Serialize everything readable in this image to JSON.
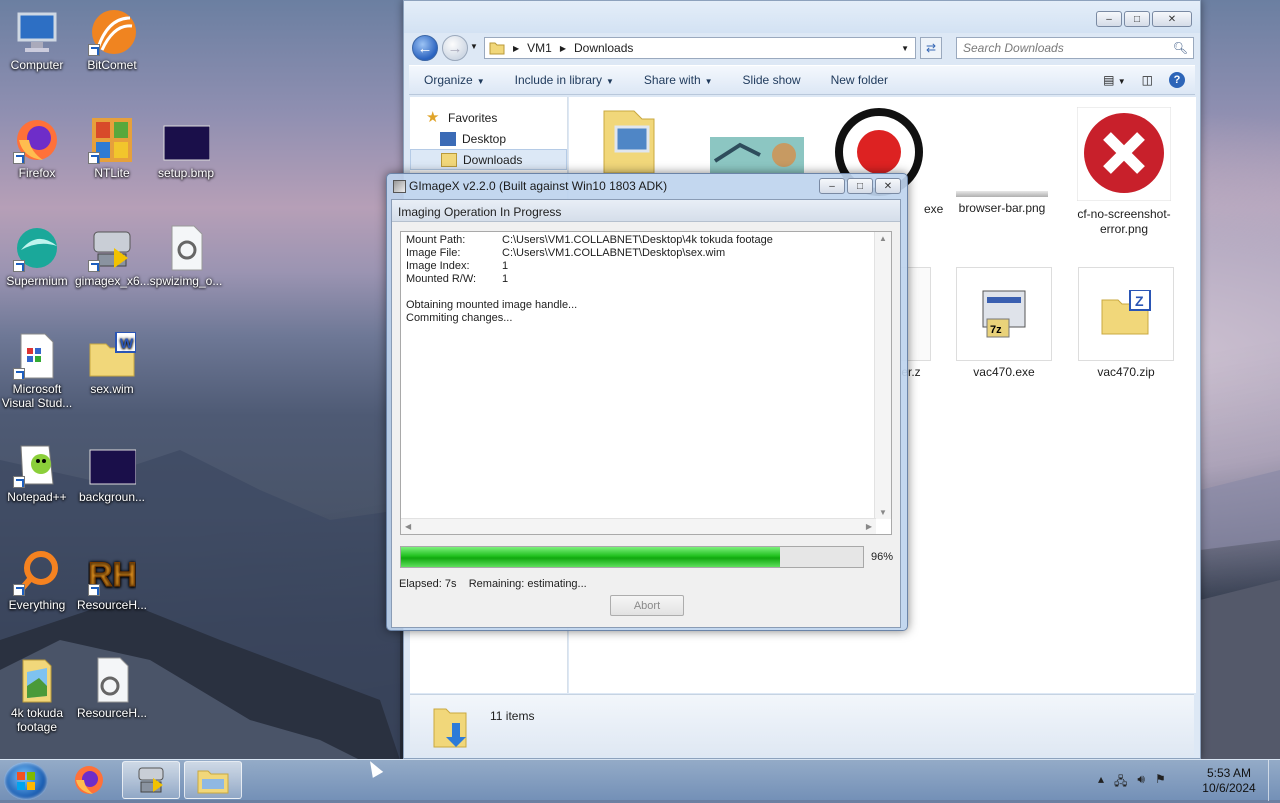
{
  "desktop": {
    "icons": [
      {
        "label": "Computer",
        "icon": "computer-icon"
      },
      {
        "label": "BitComet",
        "icon": "bitcomet-icon"
      },
      {
        "label": "Firefox",
        "icon": "firefox-icon"
      },
      {
        "label": "NTLite",
        "icon": "ntlite-icon"
      },
      {
        "label": "setup.bmp",
        "icon": "bitmap-icon"
      },
      {
        "label": "Supermium",
        "icon": "supermium-icon"
      },
      {
        "label": "gimagex_x6...",
        "icon": "gimagex-icon"
      },
      {
        "label": "spwizimg_o...",
        "icon": "settings-file-icon"
      },
      {
        "label": "Microsoft Visual Stud...",
        "icon": "visual-studio-icon"
      },
      {
        "label": "sex.wim",
        "icon": "wim-file-icon"
      },
      {
        "label": "Notepad++",
        "icon": "notepadpp-icon"
      },
      {
        "label": "backgroun...",
        "icon": "bitmap-icon"
      },
      {
        "label": "Everything",
        "icon": "everything-icon"
      },
      {
        "label": "ResourceH...",
        "icon": "resourcehacker-icon"
      },
      {
        "label": "4k tokuda footage",
        "icon": "folder-icon"
      },
      {
        "label": "ResourceH...",
        "icon": "settings-file-icon"
      }
    ]
  },
  "explorer": {
    "breadcrumb": [
      "VM1",
      "Downloads"
    ],
    "search_placeholder": "Search Downloads",
    "toolbar": {
      "organize": "Organize",
      "include": "Include in library",
      "share": "Share with",
      "slideshow": "Slide show",
      "newfolder": "New folder"
    },
    "nav": {
      "favorites": "Favorites",
      "desktop": "Desktop",
      "downloads": "Downloads"
    },
    "files": [
      {
        "label": "",
        "icon": "folder-icon"
      },
      {
        "label": "",
        "icon": "image-thumbnail-icon"
      },
      {
        "label": "exe",
        "icon": "record-app-icon"
      },
      {
        "label": "browser-bar.png",
        "icon": "png-thumbnail-icon"
      },
      {
        "label": "cf-no-screenshot-error.png",
        "icon": "error-image-icon"
      },
      {
        "label": "er.z",
        "icon": "file-icon"
      },
      {
        "label": "vac470.exe",
        "icon": "installer-icon"
      },
      {
        "label": "vac470.zip",
        "icon": "zip-folder-icon"
      }
    ],
    "status": "11 items"
  },
  "dialog": {
    "title": "GImageX v2.2.0 (Built against Win10 1803 ADK)",
    "header": "Imaging Operation In Progress",
    "log": [
      {
        "key": "Mount Path:",
        "value": "C:\\Users\\VM1.COLLABNET\\Desktop\\4k tokuda footage"
      },
      {
        "key": "Image File:",
        "value": "C:\\Users\\VM1.COLLABNET\\Desktop\\sex.wim"
      },
      {
        "key": "Image Index:",
        "value": "1"
      },
      {
        "key": "Mounted R/W:",
        "value": "1"
      }
    ],
    "messages": [
      "Obtaining mounted image handle...",
      "Commiting changes..."
    ],
    "progress": 0.82,
    "progress_label": "96%",
    "elapsed": "Elapsed: 7s",
    "remaining": "Remaining: estimating...",
    "abort": "Abort"
  },
  "taskbar": {
    "time": "5:53 AM",
    "date": "10/6/2024"
  },
  "colors": {
    "progress_green": "#21c11f",
    "window_frame": "#dde8f5",
    "taskbar": "#7f9cc4"
  }
}
